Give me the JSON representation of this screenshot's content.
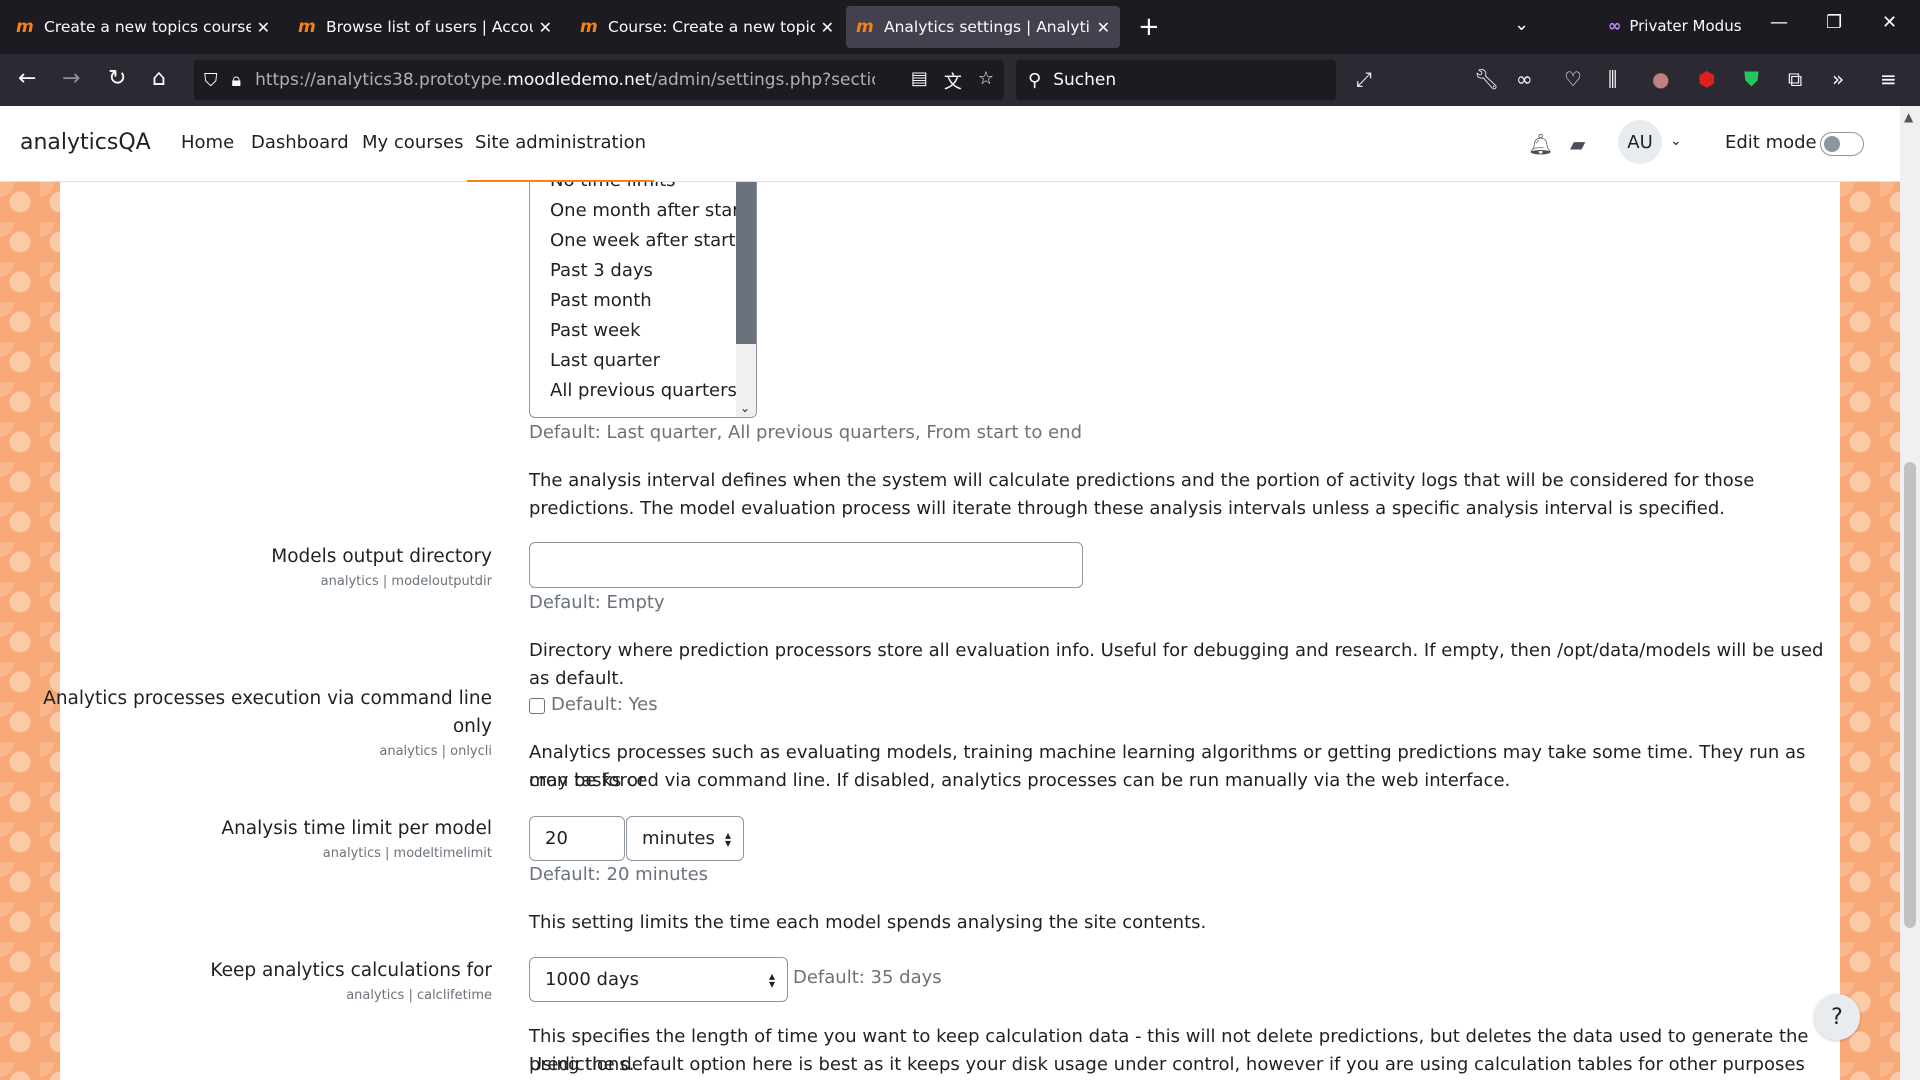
{
  "browser": {
    "tabs": [
      {
        "title": "Create a new topics course: Log",
        "active": false
      },
      {
        "title": "Browse list of users | Accounts |",
        "active": false
      },
      {
        "title": "Course: Create a new topics cou",
        "active": false
      },
      {
        "title": "Analytics settings | Analytics | A",
        "active": true
      }
    ],
    "private_label": "Privater Modus",
    "url_prefix": "https://analytics38.prototype.",
    "url_domain": "moodledemo.net",
    "url_suffix": "/admin/settings.php?section=analy",
    "search_placeholder": "Suchen"
  },
  "site": {
    "brand": "analyticsQA",
    "nav": [
      "Home",
      "Dashboard",
      "My courses",
      "Site administration"
    ],
    "active_nav": "Site administration",
    "avatar_initials": "AU",
    "edit_mode_label": "Edit mode",
    "edit_mode_on": false
  },
  "intervals": {
    "options": [
      "No time limits",
      "One month after start",
      "One week after start",
      "Past 3 days",
      "Past month",
      "Past week",
      "Last quarter",
      "All previous quarters"
    ],
    "default": "Default: Last quarter, All previous quarters, From start to end",
    "description": "The analysis interval defines when the system will calculate predictions and the portion of activity logs that will be considered for those predictions. The model evaluation process will iterate through these analysis intervals unless a specific analysis interval is specified."
  },
  "modeloutputdir": {
    "label": "Models output directory",
    "id": "analytics | modeloutputdir",
    "value": "",
    "default": "Default: Empty",
    "description": "Directory where prediction processors store all evaluation info. Useful for debugging and research. If empty, then /opt/data/models will be used as default."
  },
  "onlycli": {
    "label_line1": "Analytics processes execution via command line",
    "label_line2": "only",
    "id": "analytics | onlycli",
    "checked": false,
    "default": "Default: Yes",
    "description_line1": "Analytics processes such as evaluating models, training machine learning algorithms or getting predictions may take some time. They run as cron tasks or",
    "description_line2": "may be forced via command line. If disabled, analytics processes can be run manually via the web interface."
  },
  "modeltimelimit": {
    "label": "Analysis time limit per model",
    "id": "analytics | modeltimelimit",
    "value": "20",
    "unit": "minutes",
    "default": "Default: 20 minutes",
    "description": "This setting limits the time each model spends analysing the site contents."
  },
  "calclifetime": {
    "label": "Keep analytics calculations for",
    "id": "analytics | calclifetime",
    "value": "1000 days",
    "default": "Default: 35 days",
    "description_line1": "This specifies the length of time you want to keep calculation data - this will not delete predictions, but deletes the data used to generate the predictions.",
    "description_line2": "Using the default option here is best as it keeps your disk usage under control, however if you are using calculation tables for other purposes you may"
  },
  "help_label": "?",
  "colors": {
    "accent": "#f98012",
    "border": "#8f959e",
    "muted": "#6a737b"
  }
}
